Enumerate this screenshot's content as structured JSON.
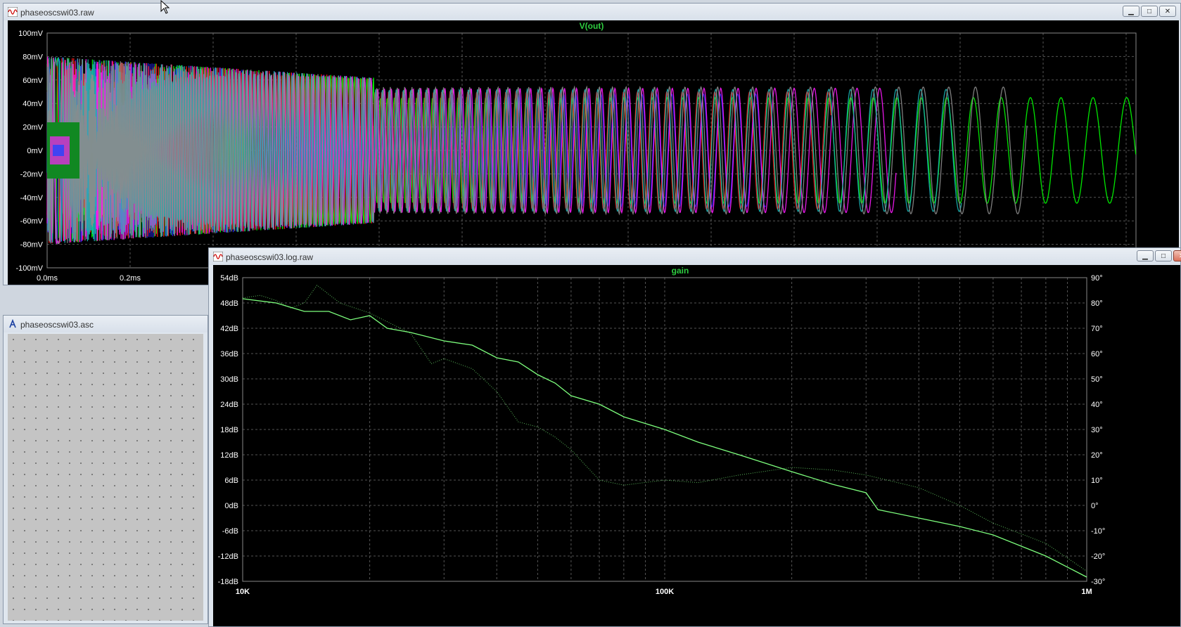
{
  "windows": {
    "raw": {
      "title": "phaseoscswi03.raw",
      "trace_label": "V(out)",
      "y_ticks": [
        "100mV",
        "80mV",
        "60mV",
        "40mV",
        "20mV",
        "0mV",
        "-20mV",
        "-40mV",
        "-60mV",
        "-80mV",
        "-100mV"
      ],
      "x_ticks": [
        "0.0ms",
        "0.2ms"
      ]
    },
    "asc": {
      "title": "phaseoscswi03.asc"
    },
    "log": {
      "title": "phaseoscswi03.log.raw",
      "trace_label": "gain",
      "y_ticks_left": [
        "54dB",
        "48dB",
        "42dB",
        "36dB",
        "30dB",
        "24dB",
        "18dB",
        "12dB",
        "6dB",
        "0dB",
        "-6dB",
        "-12dB",
        "-18dB"
      ],
      "y_ticks_right": [
        "90°",
        "80°",
        "70°",
        "60°",
        "50°",
        "40°",
        "30°",
        "20°",
        "10°",
        "0°",
        "-10°",
        "-20°",
        "-30°"
      ],
      "x_ticks": [
        "10K",
        "100K",
        "1M"
      ]
    }
  },
  "window_buttons": {
    "minimize": "▁",
    "maximize": "□",
    "close": "✕"
  },
  "colors": {
    "plot_bg": "#000000",
    "grid": "#555555",
    "trace_green": "#00ff33",
    "title_green": "#2ecc40"
  },
  "chart_data": [
    {
      "type": "line",
      "title": "V(out)",
      "ylim": [
        -100,
        100
      ],
      "yunit": "mV",
      "series": [
        {
          "color": "#00ff00",
          "amp": 45,
          "start_period": 0.9
        },
        {
          "color": "#2a2aff",
          "amp": 48,
          "start_period": 0.8
        },
        {
          "color": "#ff1a1a",
          "amp": 50,
          "start_period": 0.75
        },
        {
          "color": "#ff1aff",
          "amp": 53,
          "start_period": 0.7
        },
        {
          "color": "#19b3b3",
          "amp": 52,
          "start_period": 0.72
        },
        {
          "color": "#8c8c8c",
          "amp": 54,
          "start_period": 0.68
        }
      ]
    },
    {
      "type": "line",
      "title": "gain",
      "xscale": "log",
      "xlim": [
        10000,
        1000000
      ],
      "ylim": [
        -18,
        54
      ],
      "y2lim": [
        -30,
        90
      ],
      "series": [
        {
          "name": "gain (dB)",
          "x": [
            10000,
            12000,
            14000,
            16000,
            18000,
            20000,
            22000,
            25000,
            30000,
            35000,
            40000,
            45000,
            50000,
            55000,
            60000,
            70000,
            80000,
            100000,
            120000,
            150000,
            200000,
            250000,
            300000,
            320000,
            400000,
            500000,
            600000,
            800000,
            1000000
          ],
          "y": [
            49,
            48,
            46,
            46,
            44,
            45,
            42,
            41,
            39,
            38,
            35,
            34,
            31,
            29,
            26,
            24,
            21,
            18,
            15,
            12,
            8,
            5,
            3,
            -1,
            -3,
            -5,
            -7,
            -12,
            -17
          ]
        },
        {
          "name": "phase (deg)",
          "x": [
            10000,
            11000,
            12000,
            13000,
            14000,
            15000,
            17000,
            20000,
            25000,
            28000,
            30000,
            35000,
            40000,
            45000,
            50000,
            55000,
            60000,
            70000,
            80000,
            100000,
            120000,
            150000,
            200000,
            250000,
            300000,
            400000,
            500000,
            600000,
            800000,
            1000000
          ],
          "y": [
            82,
            83,
            81,
            78,
            80,
            87,
            80,
            76,
            68,
            56,
            58,
            54,
            45,
            33,
            31,
            27,
            22,
            10,
            8,
            10,
            9,
            12,
            15,
            14,
            12,
            7,
            0,
            -7,
            -15,
            -26
          ]
        }
      ]
    }
  ]
}
